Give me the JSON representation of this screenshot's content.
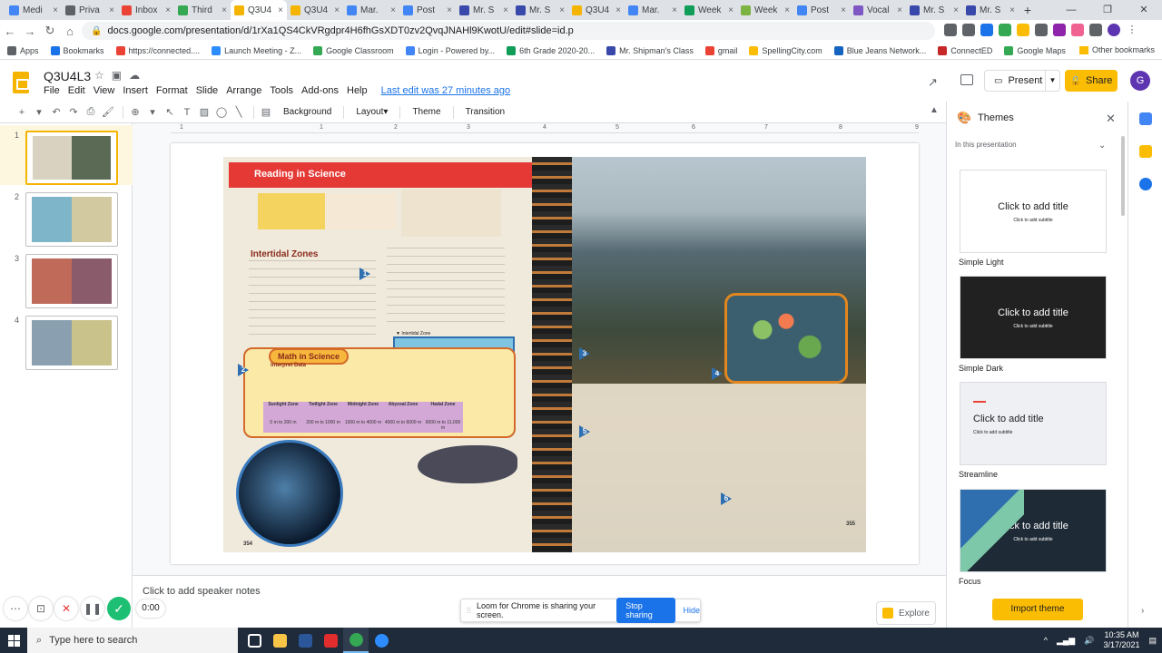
{
  "browser": {
    "tabs": [
      {
        "label": "Medi",
        "color": "#4285f4",
        "active": false
      },
      {
        "label": "Priva",
        "color": "#5f6368",
        "active": false
      },
      {
        "label": "Inbox",
        "color": "#ea4335",
        "active": false
      },
      {
        "label": "Third",
        "color": "#34a853",
        "active": false
      },
      {
        "label": "Q3U4",
        "color": "#f4b400",
        "active": true
      },
      {
        "label": "Q3U4",
        "color": "#f4b400",
        "active": false
      },
      {
        "label": "Mar.",
        "color": "#4285f4",
        "active": false
      },
      {
        "label": "Post",
        "color": "#4285f4",
        "active": false
      },
      {
        "label": "Mr. S",
        "color": "#3949ab",
        "active": false
      },
      {
        "label": "Mr. S",
        "color": "#3949ab",
        "active": false
      },
      {
        "label": "Q3U4",
        "color": "#f4b400",
        "active": false
      },
      {
        "label": "Mar.",
        "color": "#4285f4",
        "active": false
      },
      {
        "label": "Week",
        "color": "#0f9d58",
        "active": false
      },
      {
        "label": "Week",
        "color": "#7cb342",
        "active": false
      },
      {
        "label": "Post",
        "color": "#4285f4",
        "active": false
      },
      {
        "label": "Vocal",
        "color": "#7e57c2",
        "active": false
      },
      {
        "label": "Mr. S",
        "color": "#3949ab",
        "active": false
      },
      {
        "label": "Mr. S",
        "color": "#3949ab",
        "active": false
      }
    ],
    "new_tab": "+",
    "url": "docs.google.com/presentation/d/1rXa1QS4CkVRgdpr4H6fhGsXDT0zv2QvqJNAHl9KwotU/edit#slide=id.p",
    "bookmarks": [
      {
        "label": "Apps",
        "color": "#5f6368"
      },
      {
        "label": "Bookmarks",
        "color": "#1a73e8"
      },
      {
        "label": "https://connected....",
        "color": "#ea4335"
      },
      {
        "label": "Launch Meeting - Z...",
        "color": "#2d8cff"
      },
      {
        "label": "Google Classroom",
        "color": "#34a853"
      },
      {
        "label": "Login - Powered by...",
        "color": "#4285f4"
      },
      {
        "label": "6th Grade 2020-20...",
        "color": "#0f9d58"
      },
      {
        "label": "Mr. Shipman's Class",
        "color": "#3949ab"
      },
      {
        "label": "gmail",
        "color": "#ea4335"
      },
      {
        "label": "SpellingCity.com",
        "color": "#fbbc04"
      },
      {
        "label": "Blue Jeans Network...",
        "color": "#1565c0"
      },
      {
        "label": "ConnectED",
        "color": "#c62828"
      },
      {
        "label": "Google Maps",
        "color": "#34a853"
      }
    ],
    "other_bookmarks": "Other bookmarks"
  },
  "doc": {
    "title": "Q3U4L3",
    "menu": [
      "File",
      "Edit",
      "View",
      "Insert",
      "Format",
      "Slide",
      "Arrange",
      "Tools",
      "Add-ons",
      "Help"
    ],
    "last_edit": "Last edit was 27 minutes ago",
    "present": "Present",
    "share": "Share",
    "avatar": "G"
  },
  "toolbar": {
    "background": "Background",
    "layout": "Layout",
    "theme": "Theme",
    "transition": "Transition"
  },
  "ruler": [
    "1",
    "1",
    "2",
    "3",
    "4",
    "5",
    "6",
    "7",
    "8",
    "9"
  ],
  "filmstrip": {
    "slides": [
      "1",
      "2",
      "3",
      "4"
    ],
    "selected": 0
  },
  "slide_content": {
    "banner": "Reading in Science",
    "heading": "Intertidal Zones",
    "math_title": "Math in Science",
    "interpret": "Interpret Data",
    "zones": [
      {
        "name": "Sunlight Zone",
        "depth": "0 m to 200 m"
      },
      {
        "name": "Twilight Zone",
        "depth": "200 m to 1000 m"
      },
      {
        "name": "Midnight Zone",
        "depth": "1000 m to 4000 m"
      },
      {
        "name": "Abyssal Zone",
        "depth": "4000 m to 6000 m"
      },
      {
        "name": "Hadal Zone",
        "depth": "6000 m to 11,000 m"
      }
    ],
    "interlabel": "▼ Intertidal Zone",
    "page_left": "354",
    "page_right": "355",
    "markers": [
      "1",
      "2",
      "3",
      "4",
      "5",
      "6"
    ]
  },
  "notes": {
    "placeholder": "Click to add speaker notes"
  },
  "explore": "Explore",
  "loom": {
    "timer": "0:00",
    "message": "Loom for Chrome is sharing your screen.",
    "stop": "Stop sharing",
    "hide": "Hide"
  },
  "themes_panel": {
    "title": "Themes",
    "section": "In this presentation",
    "themes": [
      {
        "name": "Simple Light",
        "title": "Click to add title",
        "subtitle": "Click to add subtitle",
        "bg": "#ffffff",
        "fg": "#202124"
      },
      {
        "name": "Simple Dark",
        "title": "Click to add title",
        "subtitle": "Click to add subtitle",
        "bg": "#212121",
        "fg": "#ffffff"
      },
      {
        "name": "Streamline",
        "title": "Click to add title",
        "subtitle": "Click to add subtitle",
        "bg": "#eef0f4",
        "fg": "#202124"
      },
      {
        "name": "Focus",
        "title": "Click to add title",
        "subtitle": "Click to add subtitle",
        "bg": "#1e2a36",
        "fg": "#ffffff"
      }
    ],
    "import": "Import theme"
  },
  "taskbar": {
    "search": "Type here to search",
    "time": "10:35 AM",
    "date": "3/17/2021"
  }
}
